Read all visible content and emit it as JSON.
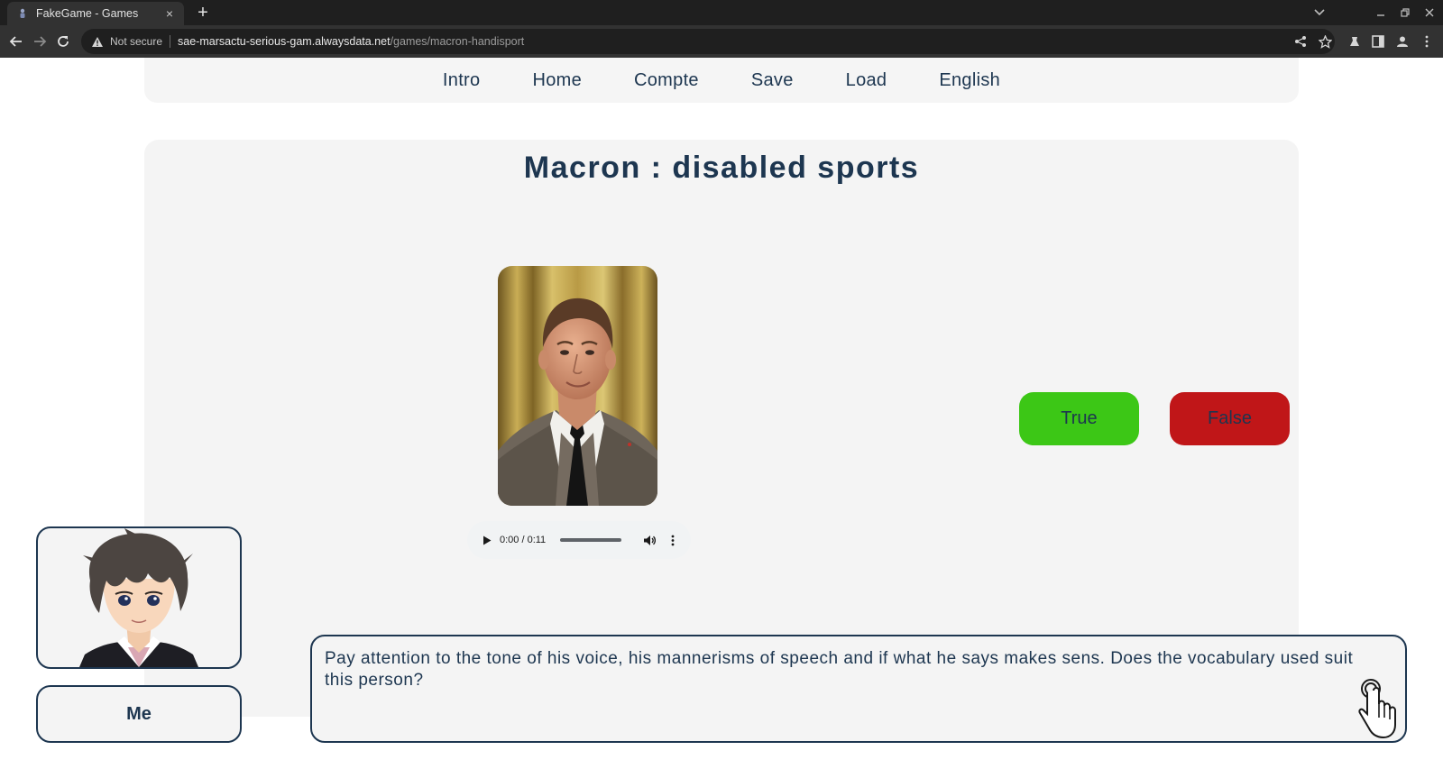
{
  "browser": {
    "tab_title": "FakeGame - Games",
    "tab_close": "×",
    "new_tab": "+",
    "not_secure": "Not secure",
    "url_host": "sae-marsactu-serious-gam.alwaysdata.net",
    "url_path": "/games/macron-handisport"
  },
  "nav": {
    "items": [
      "Intro",
      "Home",
      "Compte",
      "Save",
      "Load",
      "English"
    ]
  },
  "game": {
    "title": "Macron : disabled sports",
    "audio_time": "0:00 / 0:11",
    "true_label": "True",
    "false_label": "False"
  },
  "dialogue": {
    "speaker": "Me",
    "text": "Pay attention to the tone of his voice, his mannerisms of speech and if what he says makes sens. Does the vocabulary used suit this person?"
  },
  "colors": {
    "text_primary": "#1d3650",
    "true_button": "#3cc716",
    "false_button": "#c01618",
    "card_background": "#f4f4f4"
  },
  "icons": [
    "favicon-icon",
    "back-icon",
    "forward-icon",
    "reload-icon",
    "warning-icon",
    "share-icon",
    "star-icon",
    "extensions-icon",
    "sidepanel-icon",
    "profile-icon",
    "menu-icon",
    "play-icon",
    "volume-icon",
    "more-options-icon",
    "hand-pointer-icon"
  ]
}
